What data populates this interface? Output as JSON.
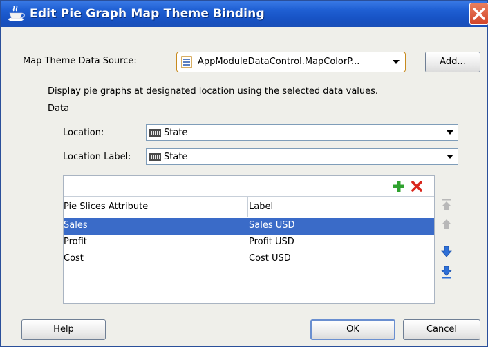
{
  "window": {
    "title": "Edit Pie Graph  Map Theme Binding"
  },
  "data_source": {
    "label": "Map Theme Data Source:",
    "value": "AppModuleDataControl.MapColorP...",
    "add_button": "Add..."
  },
  "description": "Display pie graphs at designated location using the selected data values.",
  "data_section": {
    "heading": "Data",
    "location_label": "Location:",
    "location_value": "State",
    "location_label_label": "Location Label:",
    "location_label_value": "State"
  },
  "table": {
    "columns": [
      "Pie Slices Attribute",
      "Label"
    ],
    "rows": [
      {
        "attribute": "Sales",
        "label": "Sales USD",
        "selected": true
      },
      {
        "attribute": "Profit",
        "label": "Profit USD",
        "selected": false
      },
      {
        "attribute": "Cost",
        "label": "Cost USD",
        "selected": false
      }
    ]
  },
  "buttons": {
    "help": "Help",
    "ok": "OK",
    "cancel": "Cancel"
  },
  "colors": {
    "titlebar": "#1f5fd3",
    "selection": "#3a6bc8",
    "add_icon": "#2fa22f",
    "delete_icon": "#d9261c",
    "move_icon_active": "#2e6fd6",
    "move_icon_inactive": "#b8b8b8"
  }
}
